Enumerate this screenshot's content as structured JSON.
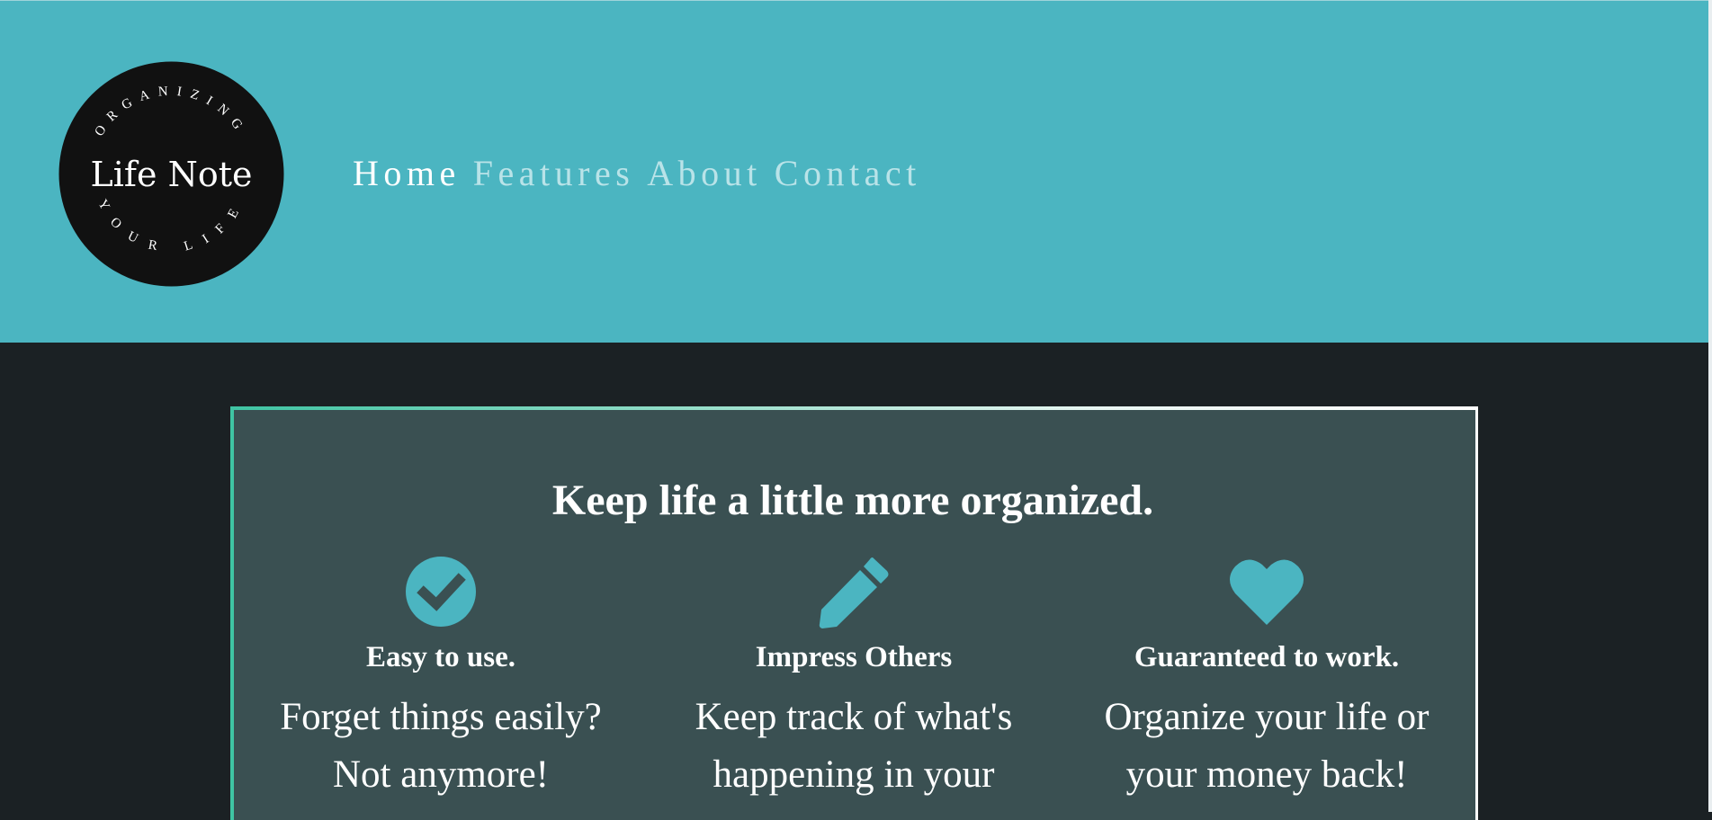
{
  "logo": {
    "name": "Life Note",
    "arc_top": "ORGANIZING",
    "arc_bottom": "YOUR LIFE"
  },
  "nav": {
    "items": [
      {
        "label": "Home",
        "active": true
      },
      {
        "label": "Features",
        "active": false
      },
      {
        "label": "About",
        "active": false
      },
      {
        "label": "Contact",
        "active": false
      }
    ]
  },
  "features_panel": {
    "title": "Keep life a little more organized.",
    "items": [
      {
        "icon": "check-circle-icon",
        "heading": "Easy to use.",
        "text": "Forget things easily? Not anymore!"
      },
      {
        "icon": "pencil-icon",
        "heading": "Impress Others",
        "text": "Keep track of what's happening in your"
      },
      {
        "icon": "heart-icon",
        "heading": "Guaranteed to work.",
        "text": "Organize your life or your money back!"
      }
    ]
  },
  "colors": {
    "header_bg": "#4bb5c1",
    "page_bg": "#1b2124",
    "panel_bg": "#3a5052",
    "accent": "#4bb5c1",
    "border_green": "#3fc4a3"
  }
}
